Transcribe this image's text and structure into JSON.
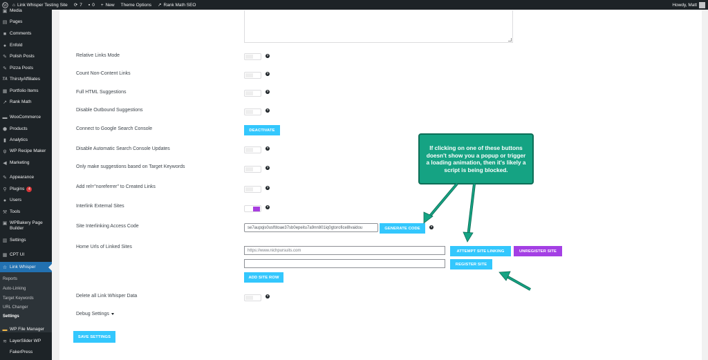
{
  "adminbar": {
    "site_name": "Link Whisper Testing Site",
    "updates_count": "7",
    "comments_count": "0",
    "new_label": "New",
    "theme_options": "Theme Options",
    "rank_math": "Rank Math SEO",
    "howdy": "Howdy, Matt"
  },
  "sidebar": {
    "items": [
      {
        "label": "Media",
        "icon": "media-icon"
      },
      {
        "label": "Pages",
        "icon": "pages-icon"
      },
      {
        "label": "Comments",
        "icon": "comments-icon"
      },
      {
        "label": "Enfold",
        "icon": "enfold-icon"
      },
      {
        "label": "Polish Posts",
        "icon": "pin-icon"
      },
      {
        "label": "Pizza Posts",
        "icon": "pin-icon"
      },
      {
        "label": "ThirstyAffiliates",
        "icon": "ta-icon"
      },
      {
        "label": "Portfolio Items",
        "icon": "portfolio-icon"
      },
      {
        "label": "Rank Math",
        "icon": "rankmath-icon"
      },
      {
        "label": "WooCommerce",
        "icon": "woocommerce-icon"
      },
      {
        "label": "Products",
        "icon": "products-icon"
      },
      {
        "label": "Analytics",
        "icon": "analytics-icon"
      },
      {
        "label": "WP Recipe Maker",
        "icon": "recipe-icon"
      },
      {
        "label": "Marketing",
        "icon": "marketing-icon"
      },
      {
        "label": "Appearance",
        "icon": "appearance-icon"
      },
      {
        "label": "Plugins",
        "icon": "plugins-icon",
        "badge": "4"
      },
      {
        "label": "Users",
        "icon": "users-icon"
      },
      {
        "label": "Tools",
        "icon": "tools-icon"
      },
      {
        "label": "WPBakery Page Builder",
        "icon": "wpbakery-icon"
      },
      {
        "label": "Settings",
        "icon": "settings-icon"
      },
      {
        "label": "CPT UI",
        "icon": "cptui-icon"
      },
      {
        "label": "Link Whisper",
        "icon": "star-icon"
      },
      {
        "label": "WP File Manager",
        "icon": "folder-icon"
      },
      {
        "label": "LayerSlider WP",
        "icon": "layerslider-icon"
      },
      {
        "label": "FakerPress",
        "icon": "fakerpress-icon"
      }
    ],
    "submenu": [
      "Reports",
      "Auto-Linking",
      "Target Keywords",
      "URL Changer",
      "Settings"
    ]
  },
  "settings": {
    "relative_links": "Relative Links Mode",
    "count_non_content": "Count Non-Content Links",
    "full_html": "Full HTML Suggestions",
    "disable_outbound": "Disable Outbound Suggestions",
    "google_console": "Connect to Google Search Console",
    "deactivate": "DEACTIVATE",
    "disable_console_updates": "Disable Automatic Search Console Updates",
    "only_target_keywords": "Only make suggestions based on Target Keywords",
    "noreferrer": "Add rel=\"noreferrer\" to Created Links",
    "interlink_external": "Interlink External Sites",
    "access_code_label": "Site Interlinking Access Code",
    "access_code_value": "se7aupqis0usftitoae37sb0epeitu7a9nn801iq0gtorofice8lvaidou",
    "generate_code": "GENERATE CODE",
    "home_urls_label": "Home Urls of Linked Sites",
    "url_1": "https://www.nichpursuits.com",
    "url_2": "",
    "attempt_linking": "ATTEMPT SITE LINKING",
    "unregister_site": "UNREGISTER SITE",
    "register_site": "REGISTER SITE",
    "add_site_row": "ADD SITE ROW",
    "delete_data": "Delete all Link Whisper Data",
    "debug_settings": "Debug Settings",
    "save_settings": "SAVE SETTINGS",
    "help_glyph": "?"
  },
  "callout": {
    "text": "If clicking on one of these buttons doesn't show you a popup or trigger a loading animation, then it's likely a script is being blocked."
  },
  "colors": {
    "accent_blue": "#33c7fd",
    "accent_purple": "#a43fe4",
    "callout_green": "#15a383",
    "admin_dark": "#1d2327",
    "menu_active": "#2271b1"
  }
}
